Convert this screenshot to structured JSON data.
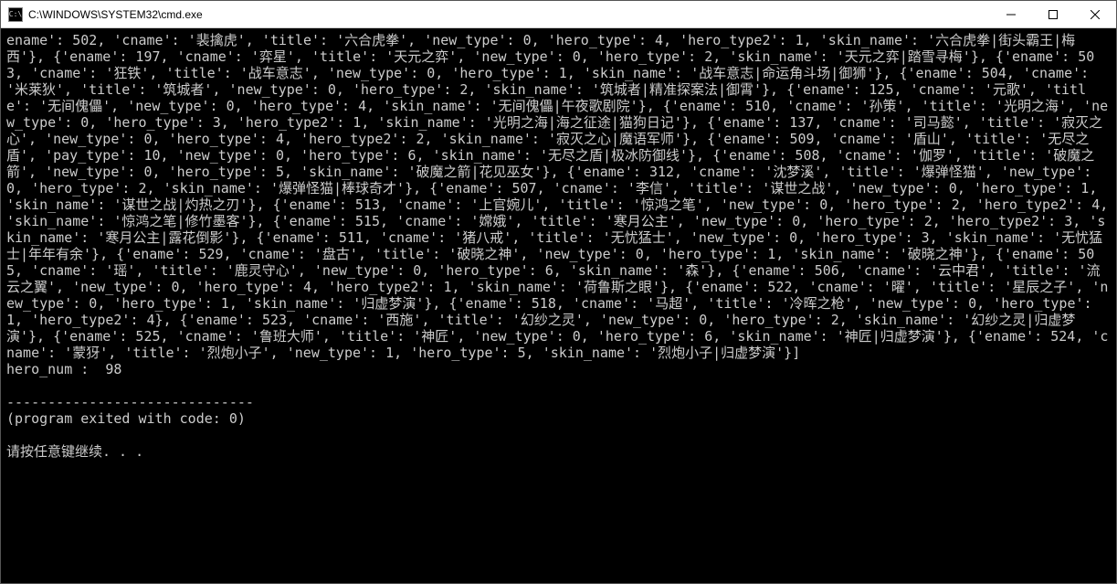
{
  "window": {
    "title": "C:\\WINDOWS\\SYSTEM32\\cmd.exe",
    "icon_label": "C:\\"
  },
  "console": {
    "body": "ename': 502, 'cname': '裴擒虎', 'title': '六合虎拳', 'new_type': 0, 'hero_type': 4, 'hero_type2': 1, 'skin_name': '六合虎拳|街头霸王|梅西'}, {'ename': 197, 'cname': '弈星', 'title': '天元之弈', 'new_type': 0, 'hero_type': 2, 'skin_name': '天元之弈|踏雪寻梅'}, {'ename': 503, 'cname': '狂铁', 'title': '战车意志', 'new_type': 0, 'hero_type': 1, 'skin_name': '战车意志|命运角斗场|御狮'}, {'ename': 504, 'cname': '米莱狄', 'title': '筑城者', 'new_type': 0, 'hero_type': 2, 'skin_name': '筑城者|精准探案法|御霄'}, {'ename': 125, 'cname': '元歌', 'title': '无间傀儡', 'new_type': 0, 'hero_type': 4, 'skin_name': '无间傀儡|午夜歌剧院'}, {'ename': 510, 'cname': '孙策', 'title': '光明之海', 'new_type': 0, 'hero_type': 3, 'hero_type2': 1, 'skin_name': '光明之海|海之征途|猫狗日记'}, {'ename': 137, 'cname': '司马懿', 'title': '寂灭之心', 'new_type': 0, 'hero_type': 4, 'hero_type2': 2, 'skin_name': '寂灭之心|魔语军师'}, {'ename': 509, 'cname': '盾山', 'title': '无尽之盾', 'pay_type': 10, 'new_type': 0, 'hero_type': 6, 'skin_name': '无尽之盾|极冰防御线'}, {'ename': 508, 'cname': '伽罗', 'title': '破魔之箭', 'new_type': 0, 'hero_type': 5, 'skin_name': '破魔之箭|花见巫女'}, {'ename': 312, 'cname': '沈梦溪', 'title': '爆弹怪猫', 'new_type': 0, 'hero_type': 2, 'skin_name': '爆弹怪猫|棒球奇才'}, {'ename': 507, 'cname': '李信', 'title': '谋世之战', 'new_type': 0, 'hero_type': 1, 'skin_name': '谋世之战|灼热之刃'}, {'ename': 513, 'cname': '上官婉儿', 'title': '惊鸿之笔', 'new_type': 0, 'hero_type': 2, 'hero_type2': 4, 'skin_name': '惊鸿之笔|修竹墨客'}, {'ename': 515, 'cname': '嫦娥', 'title': '寒月公主', 'new_type': 0, 'hero_type': 2, 'hero_type2': 3, 'skin_name': '寒月公主|露花倒影'}, {'ename': 511, 'cname': '猪八戒', 'title': '无忧猛士', 'new_type': 0, 'hero_type': 3, 'skin_name': '无忧猛士|年年有余'}, {'ename': 529, 'cname': '盘古', 'title': '破晓之神', 'new_type': 0, 'hero_type': 1, 'skin_name': '破晓之神'}, {'ename': 505, 'cname': '瑶', 'title': '鹿灵守心', 'new_type': 0, 'hero_type': 6, 'skin_name': '森'}, {'ename': 506, 'cname': '云中君', 'title': '流云之翼', 'new_type': 0, 'hero_type': 4, 'hero_type2': 1, 'skin_name': '荷鲁斯之眼'}, {'ename': 522, 'cname': '曜', 'title': '星辰之子', 'new_type': 0, 'hero_type': 1, 'skin_name': '归虚梦演'}, {'ename': 518, 'cname': '马超', 'title': '冷晖之枪', 'new_type': 0, 'hero_type': 1, 'hero_type2': 4}, {'ename': 523, 'cname': '西施', 'title': '幻纱之灵', 'new_type': 0, 'hero_type': 2, 'skin_name': '幻纱之灵|归虚梦演'}, {'ename': 525, 'cname': '鲁班大师', 'title': '神匠', 'new_type': 0, 'hero_type': 6, 'skin_name': '神匠|归虚梦演'}, {'ename': 524, 'cname': '蒙犽', 'title': '烈炮小子', 'new_type': 1, 'hero_type': 5, 'skin_name': '烈炮小子|归虚梦演'}]",
    "hero_line": "hero_num :  98",
    "separator": "------------------------------",
    "exit_line": "(program exited with code: 0)",
    "prompt": "请按任意键继续. . ."
  }
}
